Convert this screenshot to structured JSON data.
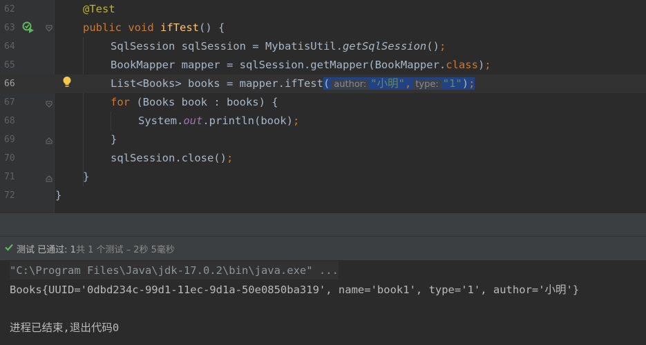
{
  "editor": {
    "line_numbers": [
      "62",
      "63",
      "64",
      "65",
      "66",
      "67",
      "68",
      "69",
      "70",
      "71",
      "72"
    ],
    "l62": {
      "annotation": "@Test"
    },
    "l63": {
      "kw_public": "public",
      "kw_void": "void",
      "method": "ifTest",
      "rest": "() {"
    },
    "l64": {
      "a": "SqlSession sqlSession = MybatisUtil.",
      "call": "getSqlSession",
      "b": "()",
      "semi": ";"
    },
    "l65": {
      "a": "BookMapper mapper = sqlSession.getMapper(BookMapper.",
      "kw_class": "class",
      "b": ")",
      "semi": ";"
    },
    "l66": {
      "a": "List<Books> books = mapper.ifTest",
      "open": "(",
      "hint_author": "author:",
      "arg1": "\"小明\"",
      "comma": ",",
      "hint_type": "type:",
      "arg2": "\"1\"",
      "close": ")",
      "semi": ";"
    },
    "l67": {
      "kw_for": "for",
      "rest": " (Books book : books) {"
    },
    "l68": {
      "a": "System.",
      "field": "out",
      "b": ".println(book)",
      "semi": ";"
    },
    "l69": {
      "code": "}"
    },
    "l70": {
      "a": "sqlSession.close()",
      "semi": ";"
    },
    "l71": {
      "code": "}"
    },
    "l72": {
      "code": "}"
    }
  },
  "status": {
    "label": "测试 已通过: ",
    "count": "1",
    "detail": "共 1 个测试 – 2秒 5毫秒"
  },
  "console": {
    "command": "\"C:\\Program Files\\Java\\jdk-17.0.2\\bin\\java.exe\" ...",
    "output": "Books{UUID='0dbd234c-99d1-11ec-9d1a-50e0850ba319', name='book1', type='1', author='小明'}",
    "exit": "进程已结束,退出代码0"
  },
  "colors": {
    "keyword": "#cc7832",
    "annotation": "#bbb529",
    "method": "#ffc66d",
    "string": "#6a8759",
    "field": "#9876aa",
    "selection": "#214283",
    "pass": "#5fb85f"
  },
  "icons": [
    "run-test-icon",
    "lightbulb-icon",
    "fold-icon",
    "check-icon"
  ]
}
